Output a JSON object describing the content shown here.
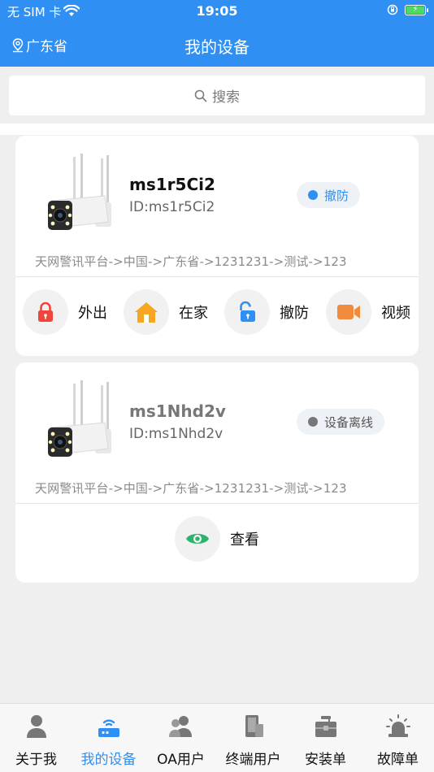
{
  "status_bar": {
    "carrier": "无 SIM 卡",
    "time": "19:05"
  },
  "nav": {
    "location": "广东省",
    "title": "我的设备"
  },
  "search": {
    "placeholder": "搜索"
  },
  "devices": [
    {
      "name": "ms1r5Ci2",
      "id": "ID:ms1r5Ci2",
      "status": "撤防",
      "status_color": "#2f8ff2",
      "path": "天网警讯平台->中国->广东省->1231231->测试->123",
      "actions": [
        {
          "label": "外出",
          "icon": "lock-icon"
        },
        {
          "label": "在家",
          "icon": "home-icon"
        },
        {
          "label": "撤防",
          "icon": "unlock-icon"
        },
        {
          "label": "视频",
          "icon": "video-icon"
        }
      ]
    },
    {
      "name": "ms1Nhd2v",
      "id": "ID:ms1Nhd2v",
      "status": "设备离线",
      "status_color": "#777777",
      "path": "天网警讯平台->中国->广东省->1231231->测试->123",
      "actions": [
        {
          "label": "查看",
          "icon": "eye-icon"
        }
      ]
    }
  ],
  "tabs": [
    {
      "label": "关于我",
      "icon": "person-icon"
    },
    {
      "label": "我的设备",
      "icon": "router-icon",
      "active": true
    },
    {
      "label": "OA用户",
      "icon": "users-icon"
    },
    {
      "label": "终端用户",
      "icon": "phone-icon"
    },
    {
      "label": "安装单",
      "icon": "toolbox-icon"
    },
    {
      "label": "故障单",
      "icon": "alarm-icon"
    }
  ],
  "colors": {
    "primary": "#2f8ff2",
    "lock": "#f0453a",
    "home": "#f5a623",
    "unlock": "#2f8ff2",
    "video": "#f08a3c",
    "eye": "#2db36b"
  }
}
